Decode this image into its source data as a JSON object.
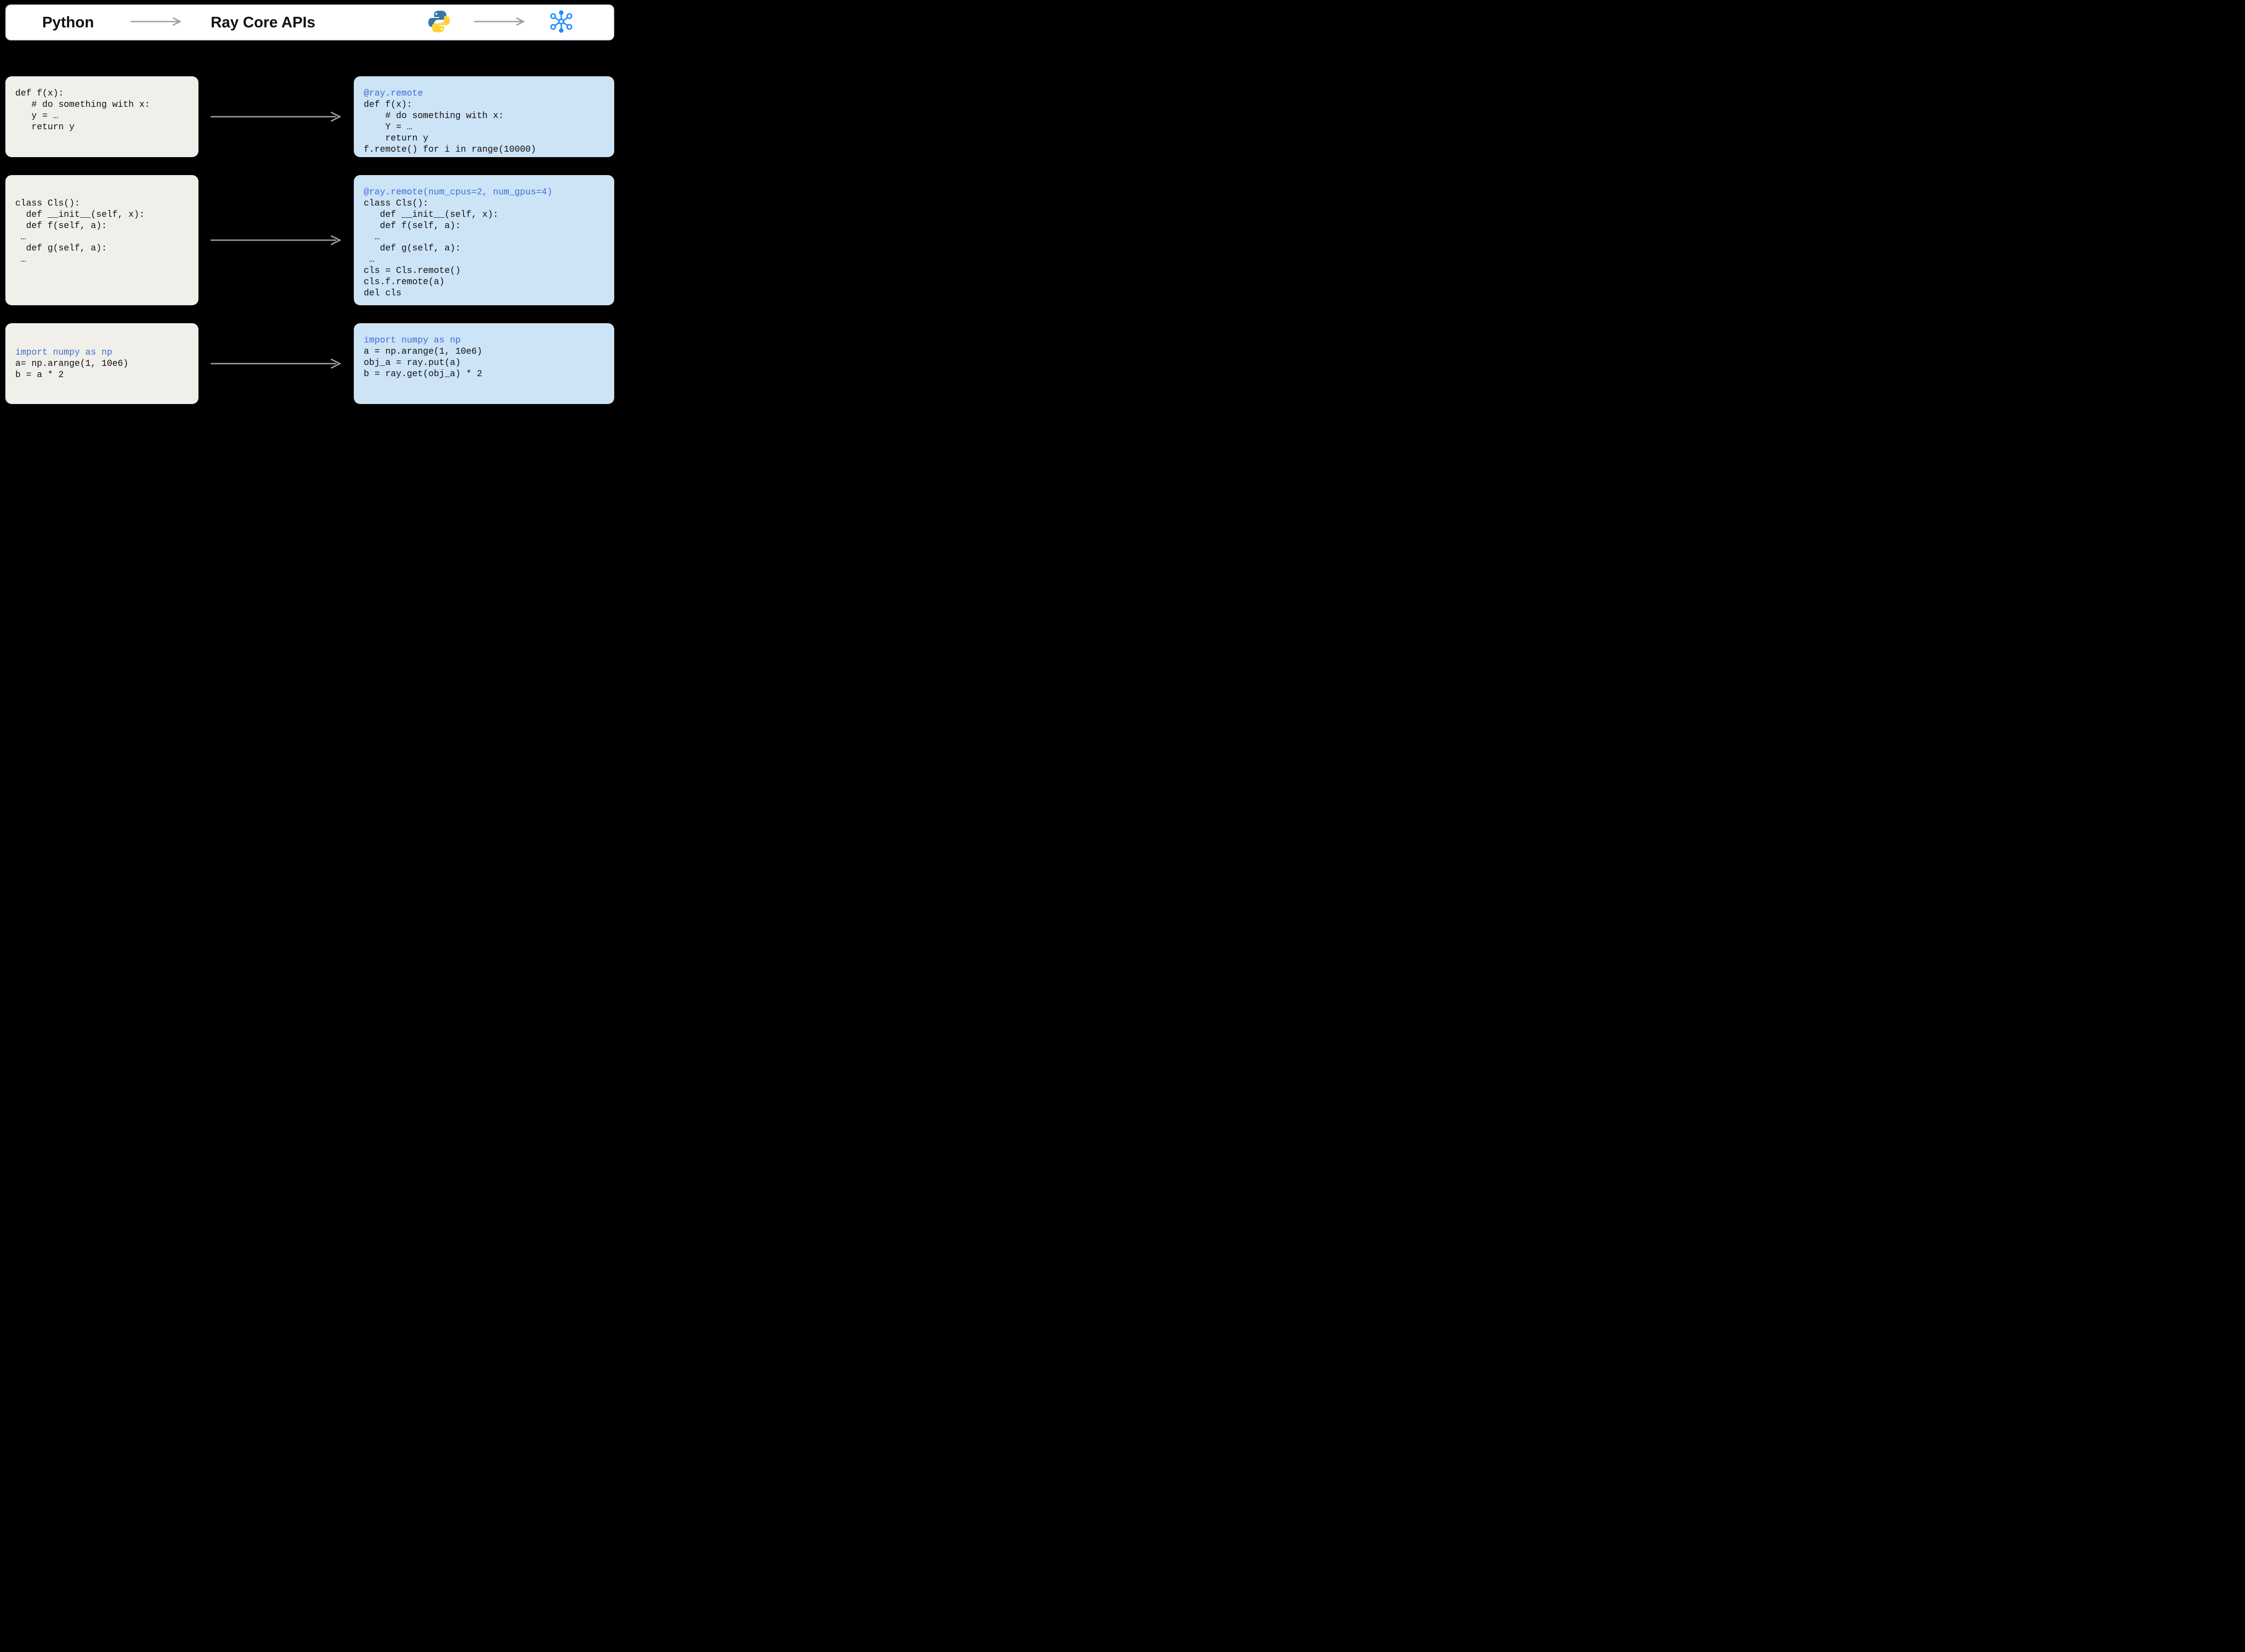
{
  "header": {
    "left_title": "Python",
    "right_title": "Ray Core APIs"
  },
  "rows": [
    {
      "left": {
        "line1": "def f(x):",
        "line2": "   # do something with x:",
        "line3": "   y = …",
        "line4": "   return y"
      },
      "right": {
        "decorator": "@ray.remote",
        "line2": "def f(x):",
        "line3": "    # do something with x:",
        "line4": "    Y = …",
        "line5": "    return y",
        "line6": "f.remote() for i in range(10000)"
      }
    },
    {
      "left": {
        "line1": "class Cls():",
        "line2": "  def __init__(self, x):",
        "line3": "  def f(self, a):",
        "line4": " …",
        "line5": "  def g(self, a):",
        "line6": " …"
      },
      "right": {
        "decorator": "@ray.remote(num_cpus=2, num_gpus=4)",
        "line2": "class Cls():",
        "line3": "   def __init__(self, x):",
        "line4": "   def f(self, a):",
        "line5": "  …",
        "line6": "   def g(self, a):",
        "line7": " …",
        "line8": "cls = Cls.remote()",
        "line9": "cls.f.remote(a)",
        "line10": "del cls"
      }
    },
    {
      "left": {
        "import": "import numpy as np",
        "line2": "a= np.arange(1, 10e6)",
        "line3": "b = a * 2"
      },
      "right": {
        "import": "import numpy as np",
        "line2": "a = np.arange(1, 10e6)",
        "line3": "obj_a = ray.put(a)",
        "line4": "b = ray.get(obj_a) * 2"
      }
    }
  ]
}
